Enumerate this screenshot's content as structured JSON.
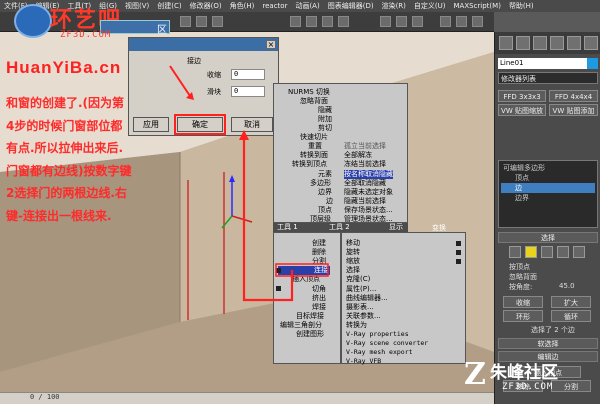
{
  "menubar": {
    "items": [
      "文件(F)",
      "编辑(E)",
      "工具(T)",
      "组(G)",
      "视图(V)",
      "创建(C)",
      "修改器(O)",
      "角色(H)",
      "reactor",
      "动画(A)",
      "图表编辑器(D)",
      "渲染(R)",
      "自定义(U)",
      "MAXScript(M)",
      "帮助(H)"
    ]
  },
  "overlay": {
    "logo_title": "环艺吧",
    "logo_sub": "ZF3D.COM",
    "logo_zone": "区",
    "site_url": "HuanYiBa.cn",
    "tutorial_text": "和窗的创建了.(因为第4步的时候门窗部位都有点.所以拉伸出来后.门窗都有边线)按数字键2选择门的两根边线.右键-连接出一根线来.",
    "watermark_title": "朱峰社区",
    "watermark_sub": "ZF3D.COM",
    "watermark_glyph": "Z"
  },
  "dialog": {
    "group_label": "接边",
    "label_segments": "收缩",
    "value_segments": "0",
    "label_slide": "滑块",
    "value_slide": "0",
    "apply_label": "应用",
    "ok_label": "确定",
    "cancel_label": "取消",
    "close_glyph": "×"
  },
  "quad_menu": {
    "top_items": [
      "NURMS 切换",
      "忽略背面",
      "隐藏",
      "附加",
      "剪切",
      "快速切片",
      "重置",
      "转换到面",
      "转换到顶点",
      "元素",
      "多边形",
      "边界",
      "边",
      "顶点",
      "顶层级"
    ],
    "right_items": [
      "孤立当前选择",
      "全部解冻",
      "冻结当前选择",
      "按名称取消隐藏",
      "全部取消隐藏",
      "隐藏未选定对象",
      "隐藏当前选择",
      "保存场景状态...",
      "管理场景状态..."
    ],
    "bar_left": "工具 1",
    "bar_mid": "工具 2",
    "bar_right": "显示",
    "bar_right2": "变换",
    "bottom_left": [
      "创建",
      "删除",
      "分割",
      "连接",
      "插入顶点",
      "切角",
      "挤出",
      "焊接",
      "目标焊接",
      "编辑三角剖分",
      "创建图形"
    ],
    "bottom_right": [
      "移动",
      "旋转",
      "缩放",
      "选择",
      "克隆(C)",
      "属性(P)...",
      "曲线编辑器...",
      "摄影表...",
      "关联参数...",
      "转换为",
      "V-Ray properties",
      "V-Ray scene converter",
      "V-Ray mesh export",
      "V-Ray VFB"
    ]
  },
  "command_panel": {
    "object_name": "Line01",
    "modifier_list": "修改器列表",
    "ffd1": "FFD 3x3x3",
    "ffd2": "FFD 4x4x4",
    "vray1": "VW 贴图缩放",
    "vray2": "VW 贴图添加",
    "stack_items": [
      "可编辑多边形",
      "顶点",
      "边",
      "边界"
    ],
    "select_rollout": "选择",
    "by_vertex": "按顶点",
    "ignore_back": "忽略背面",
    "threshold_label": "按角度:",
    "threshold_value": "45.0",
    "shrink": "收缩",
    "grow": "扩大",
    "ring": "环形",
    "loop": "循环",
    "selected_text": "选择了 2 个边",
    "soft_select": "软选择",
    "edit_edges": "编辑边",
    "insert_vertex": "插入顶点",
    "remove": "移除",
    "split": "分割"
  },
  "statusbar": {
    "frame": "0 / 100"
  }
}
